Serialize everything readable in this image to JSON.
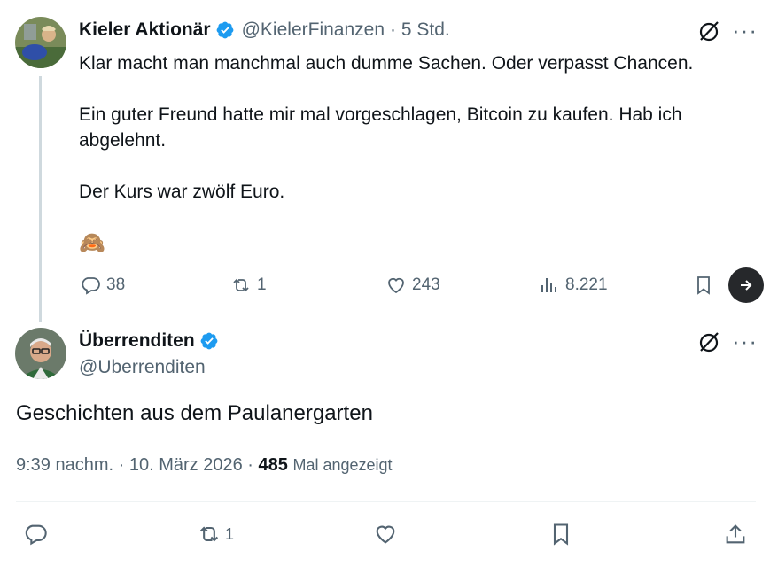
{
  "tweet1": {
    "author_name": "Kieler Aktionär",
    "author_handle": "@KielerFinanzen",
    "time": "· 5 Std.",
    "lines": [
      "Klar macht man manchmal auch dumme Sachen. Oder verpasst Chancen.",
      "Ein guter Freund hatte mir mal vorgeschlagen, Bitcoin zu kaufen. Hab ich",
      "abgelehnt.",
      "Der Kurs war zwölf Euro."
    ],
    "emoji": "🙈",
    "replies": "38",
    "reposts": "1",
    "likes": "243",
    "views": "8.221",
    "more": "···"
  },
  "tweet2": {
    "author_name": "Überrenditen",
    "author_handle": "@Uberrenditen",
    "text": "Geschichten aus dem Paulanergarten",
    "time": "9:39 nachm.",
    "sep1": "·",
    "date": "10. März 2026",
    "sep2": "·",
    "views_count": "485",
    "views_label": "Mal angezeigt",
    "reposts": "1",
    "more": "···"
  },
  "colors": {
    "verified": "#1d9bf0",
    "muted": "#536471",
    "text": "#0f1419",
    "thread_line": "#cfd9de"
  },
  "icons": [
    "verified-badge-icon",
    "grok-icon",
    "reply-icon",
    "repost-icon",
    "like-icon",
    "views-icon",
    "bookmark-icon",
    "arrow-right-icon",
    "share-icon"
  ]
}
